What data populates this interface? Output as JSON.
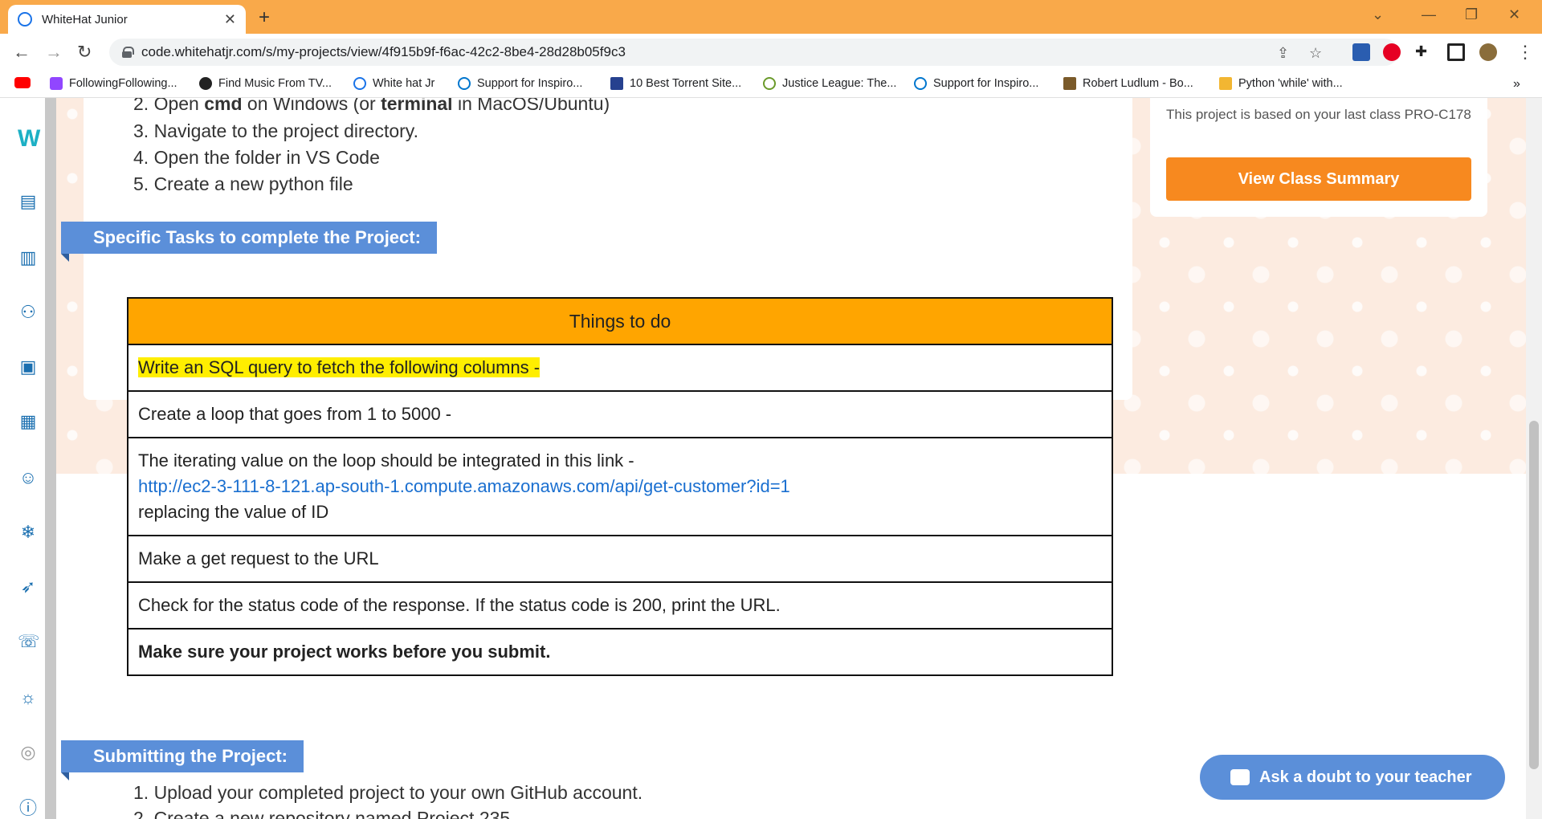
{
  "browser": {
    "tab_title": "WhiteHat Junior",
    "url": "code.whitehatjr.com/s/my-projects/view/4f915b9f-f6ac-42c2-8be4-28d28b05f9c3",
    "bookmarks": [
      "FollowingFollowing...",
      "Find Music From TV...",
      "White hat Jr",
      "Support for Inspiro...",
      "10 Best Torrent Site...",
      "Justice League: The...",
      "Support for Inspiro...",
      "Robert Ludlum - Bo...",
      "Python 'while' with..."
    ]
  },
  "steps_top": [
    {
      "num": "2.",
      "pre": "Open ",
      "b1": "cmd",
      "mid": " on Windows (or ",
      "b2": "terminal",
      "post": " in MacOS/Ubuntu)"
    },
    {
      "text": "3. Navigate to the project directory."
    },
    {
      "text": "4. Open the folder in VS Code"
    },
    {
      "text": "5. Create a new python file"
    }
  ],
  "section_tasks": "Specific Tasks to complete the Project:",
  "table": {
    "header": "Things to do",
    "rows": [
      "Write an SQL query to fetch the following columns -",
      "Create a loop that goes from 1 to 5000 -",
      "The iterating value on the loop should be integrated in this link -",
      "http://ec2-3-111-8-121.ap-south-1.compute.amazonaws.com/api/get-customer?id=1",
      "replacing the value of ID",
      "Make a get request to the URL",
      "Check for the status code of the response. If the status code is 200, print the URL.",
      "Make sure your project works before you submit."
    ]
  },
  "side_card": {
    "based_on": "This project is based on your last class PRO-C178",
    "button": "View Class Summary"
  },
  "section_submit": "Submitting the Project:",
  "steps_bottom": [
    "1. Upload your completed project to your own GitHub account.",
    "2. Create a new repository named Project 235"
  ],
  "ask_button": "Ask a doubt to your teacher",
  "colors": {
    "accent_blue": "#5b8fd9",
    "orange": "#ffa500",
    "button_orange": "#f7891f",
    "highlight": "#ffee00"
  }
}
